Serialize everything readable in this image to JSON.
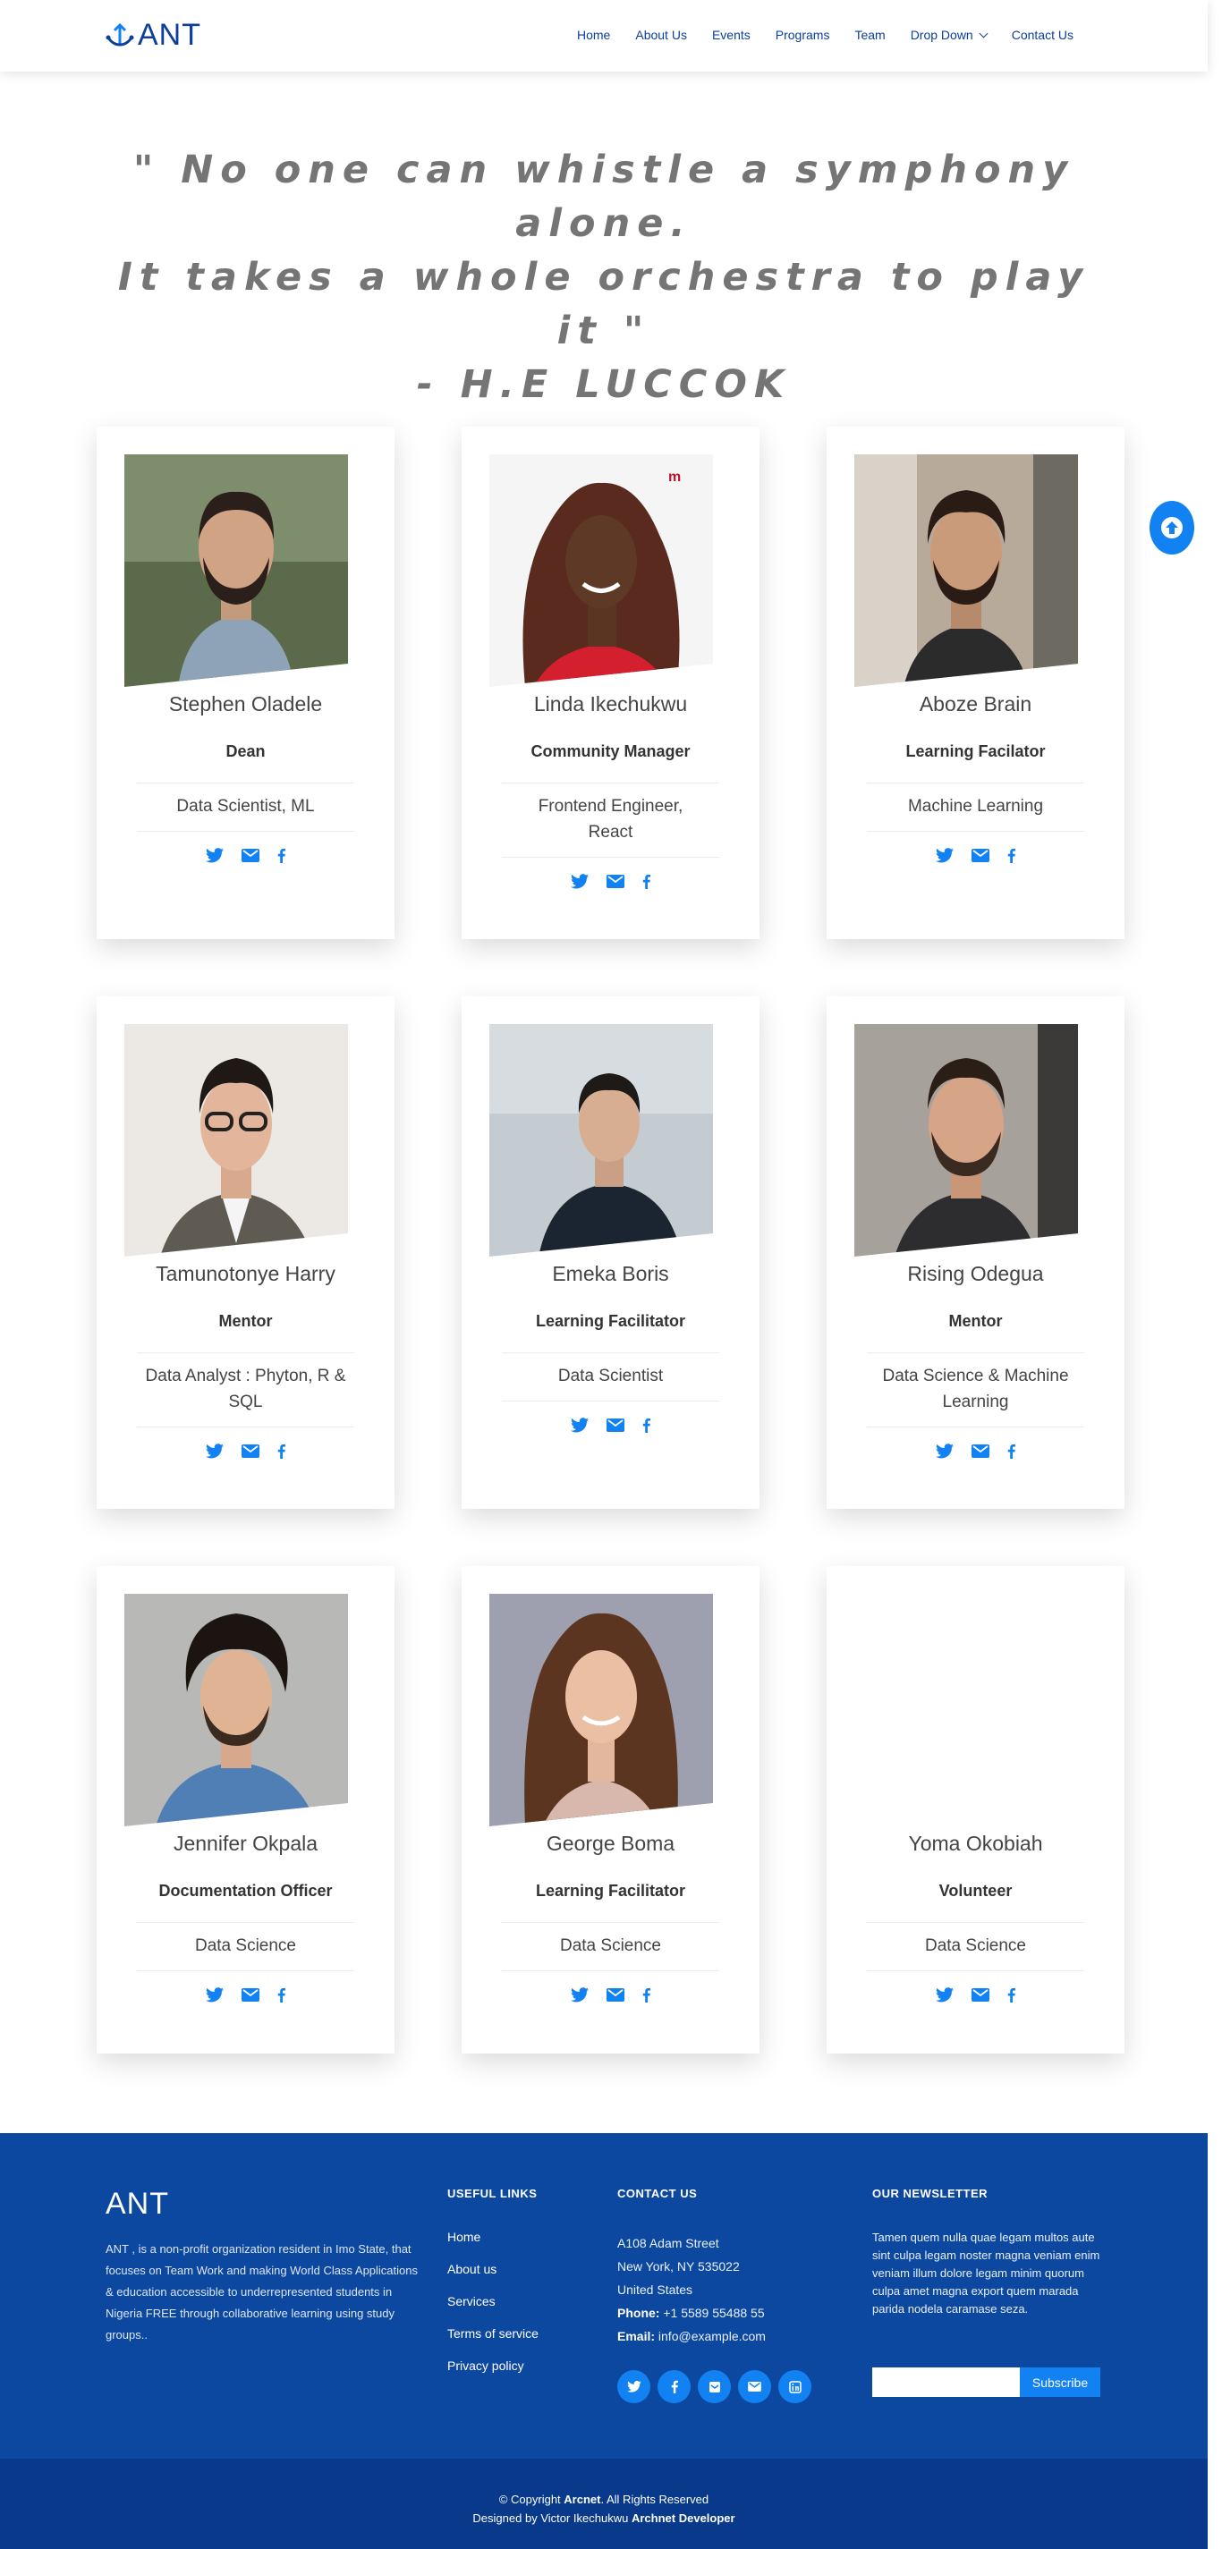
{
  "header": {
    "logo_text": "ANT",
    "nav": [
      {
        "label": "Home"
      },
      {
        "label": "About Us"
      },
      {
        "label": "Events"
      },
      {
        "label": "Programs"
      },
      {
        "label": "Team"
      },
      {
        "label": "Drop Down",
        "has_dropdown": true
      },
      {
        "label": "Contact Us"
      }
    ]
  },
  "quote": {
    "line1": "\" No one can whistle a symphony alone.",
    "line2": "It takes a whole orchestra to play it \"",
    "line3": "- H.E LUCCOK"
  },
  "team": [
    {
      "name": "Stephen Oladele",
      "role": "Dean",
      "skill": "Data Scientist, ML"
    },
    {
      "name": "Linda Ikechukwu",
      "role": "Community Manager",
      "skill": "Frontend Engineer, React"
    },
    {
      "name": "Aboze Brain",
      "role": "Learning Facilator",
      "skill": "Machine Learning"
    },
    {
      "name": "Tamunotonye Harry",
      "role": "Mentor",
      "skill": "Data Analyst : Phyton, R & SQL"
    },
    {
      "name": "Emeka Boris",
      "role": "Learning Facilitator",
      "skill": "Data Scientist"
    },
    {
      "name": "Rising Odegua",
      "role": "Mentor",
      "skill": "Data Science & Machine Learning"
    },
    {
      "name": "Jennifer Okpala",
      "role": "Documentation Officer",
      "skill": "Data Science"
    },
    {
      "name": "George Boma",
      "role": "Learning Facilitator",
      "skill": "Data Science"
    },
    {
      "name": "Yoma Okobiah",
      "role": "Volunteer",
      "skill": "Data Science"
    }
  ],
  "footer": {
    "brand": "ANT",
    "description": "ANT , is a non-profit organization resident in Imo State, that focuses on Team Work and making World Class Applications & education accessible to underrepresented students in Nigeria FREE through collaborative learning using study groups..",
    "links_heading": "USEFUL LINKS",
    "links": [
      "Home",
      "About us",
      "Services",
      "Terms of service",
      "Privacy policy"
    ],
    "contact_heading": "CONTACT US",
    "address1": "A108 Adam Street",
    "address2": "New York, NY 535022",
    "address3": "United States",
    "phone_label": "Phone:",
    "phone": "+1 5589 55488 55",
    "email_label": "Email:",
    "email": "info@example.com",
    "newsletter_heading": "OUR NEWSLETTER",
    "newsletter_text": "Tamen quem nulla quae legam multos aute sint culpa legam noster magna veniam enim veniam illum dolore legam minim quorum culpa amet magna export quem marada parida nodela caramase seza.",
    "subscribe_label": "Subscribe"
  },
  "copyright": {
    "prefix": "© Copyright",
    "company": "Arcnet",
    "suffix": ". All Rights Reserved",
    "designed_by": "Designed by",
    "designer": "Victor Ikechukwu",
    "designer_title": "Archnet Developer"
  },
  "colors": {
    "brand": "#0c3e9c",
    "accent": "#1282f2",
    "footer": "#0c48a0",
    "copyright_bar": "#09398a"
  }
}
